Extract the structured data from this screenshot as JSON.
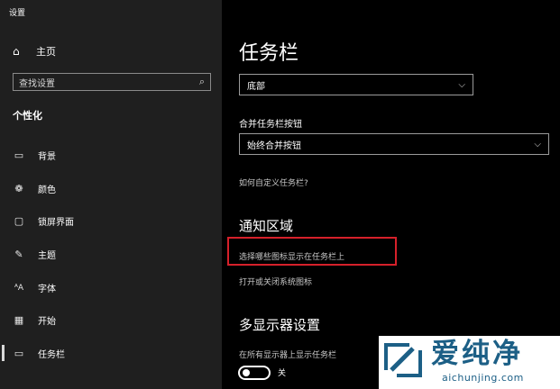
{
  "window": {
    "title": "设置"
  },
  "sidebar": {
    "home_label": "主页",
    "search_placeholder": "查找设置",
    "section_title": "个性化",
    "items": [
      {
        "label": "背景",
        "icon": "picture-icon"
      },
      {
        "label": "颜色",
        "icon": "palette-icon"
      },
      {
        "label": "锁屏界面",
        "icon": "lock-screen-icon"
      },
      {
        "label": "主题",
        "icon": "brush-icon"
      },
      {
        "label": "字体",
        "icon": "font-icon"
      },
      {
        "label": "开始",
        "icon": "start-icon"
      },
      {
        "label": "任务栏",
        "icon": "taskbar-icon"
      }
    ]
  },
  "main": {
    "title": "任务栏",
    "position_value": "底部",
    "combine_label": "合并任务栏按钮",
    "combine_value": "始终合并按钮",
    "customize_link": "如何自定义任务栏?",
    "notify_heading": "通知区域",
    "select_icons_link": "选择哪些图标显示在任务栏上",
    "system_icons_link": "打开或关闭系统图标",
    "multi_heading": "多显示器设置",
    "show_all_label": "在所有显示器上显示任务栏",
    "toggle_state": "关"
  },
  "watermark": {
    "title": "爱纯净",
    "url": "aichunjing.com"
  },
  "colors": {
    "sidebar_bg": "#1f1f1f",
    "main_bg": "#000000",
    "highlight": "#d6202a",
    "watermark_blue": "#1c5f86"
  }
}
